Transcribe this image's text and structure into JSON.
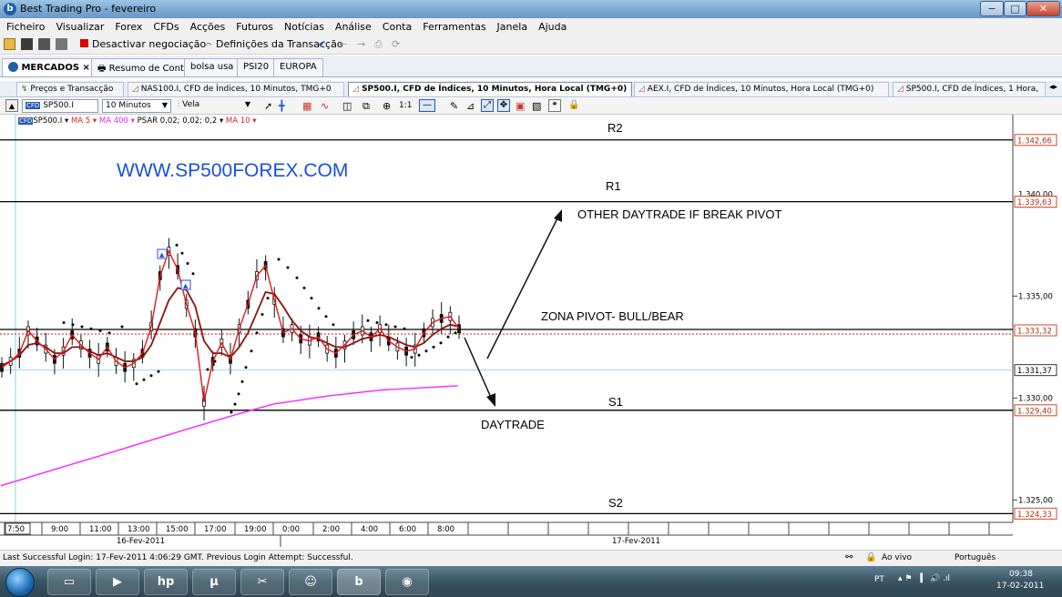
{
  "window": {
    "title": "Best Trading Pro - fevereiro",
    "app_icon": "b",
    "min_label": "−",
    "max_label": "□",
    "close_label": "✕"
  },
  "menu": [
    "Ficheiro",
    "Visualizar",
    "Forex",
    "CFDs",
    "Acções",
    "Futuros",
    "Notícias",
    "Análise",
    "Conta",
    "Ferramentas",
    "Janela",
    "Ajuda"
  ],
  "toolbar": {
    "deactivate_label": "Desactivar negociação",
    "settings_label": "Definições da Transacção"
  },
  "tabs_top": {
    "markets": "MERCADOS",
    "account": "Resumo de Conta",
    "bolsa": "bolsa usa",
    "psi": "PSI20",
    "europa": "EUROPA"
  },
  "tabs_chart": {
    "prices": "Preços e Transacção",
    "nas": "NAS100.I, CFD de Índices, 10 Minutos, TMG+0",
    "sp": "SP500.I, CFD de Índices, 10 Minutos, Hora Local (TMG+0)",
    "aex": "AEX.I, CFD de Índices, 10 Minutos, Hora Local (TMG+0)",
    "sp1h": "SP500.I, CFD de Índices, 1 Hora,"
  },
  "chart_toolbar": {
    "symbol": "SP500.I",
    "interval": "10 Minutos",
    "type": "Vela"
  },
  "indicators": {
    "symbol": "SP500.I",
    "ma5": "MA 5",
    "ma400": "MA 400",
    "psar": "PSAR 0,02; 0,02; 0,2",
    "ma10": "MA 10"
  },
  "annotations": {
    "website": "WWW.SP500FOREX.COM",
    "r2": "R2",
    "r1": "R1",
    "s1": "S1",
    "s2": "S2",
    "pivot": "ZONA PIVOT- BULL/BEAR",
    "other": "OTHER DAYTRADE IF BREAK PIVOT",
    "daytrade": "DAYTRADE"
  },
  "colors": {
    "price_line": "#cc0000",
    "ma400": "#ff22ff",
    "website": "#1a4fd8",
    "level_tag": "#d14a2a"
  },
  "chart_data": {
    "type": "line",
    "symbol": "SP500.I",
    "ylim": [
      1323.9,
      1343.9
    ],
    "y_ticks": [
      1325.0,
      1330.0,
      1335.0
    ],
    "y_tick_labels": [
      "1.325,00",
      "1.330,00",
      "1.335,00"
    ],
    "y_extra_labels": [
      "1.340,00"
    ],
    "levels": [
      {
        "name": "R2",
        "value": 1342.66,
        "label": "1.342,66"
      },
      {
        "name": "R1",
        "value": 1339.63,
        "label": "1.339,63"
      },
      {
        "name": "Pivot",
        "value": 1333.32,
        "label": "1.333,32"
      },
      {
        "name": "S1",
        "value": 1329.4,
        "label": "1.329,40"
      },
      {
        "name": "S2",
        "value": 1324.33,
        "label": "1.324,33"
      }
    ],
    "current_price": {
      "value": 1331.37,
      "label": "1.331,37"
    },
    "x_tick_labels": [
      "7:50",
      "9:00",
      "11:00",
      "13:00",
      "15:00",
      "17:00",
      "19:00",
      "0:00",
      "2:00",
      "4:00",
      "6:00",
      "8:00"
    ],
    "dates": [
      "16-Fev-2011",
      "17-Fev-2011"
    ],
    "price": [
      1331.5,
      1331.8,
      1332.2,
      1333.3,
      1332.8,
      1332.4,
      1331.9,
      1332.3,
      1333.1,
      1332.6,
      1332.2,
      1331.9,
      1332.5,
      1331.8,
      1331.5,
      1331.7,
      1332.2,
      1333.5,
      1336.0,
      1337.2,
      1336.3,
      1334.6,
      1333.2,
      1329.8,
      1331.8,
      1332.7,
      1331.9,
      1333.4,
      1334.6,
      1336.0,
      1336.5,
      1334.8,
      1333.2,
      1333.4,
      1332.9,
      1332.8,
      1333.0,
      1332.4,
      1332.2,
      1332.6,
      1333.1,
      1333.3,
      1333.0,
      1333.4,
      1332.8,
      1332.5,
      1332.3,
      1332.4,
      1333.2,
      1333.7,
      1333.9,
      1334.0,
      1333.4
    ],
    "ma": [
      1331.6,
      1331.8,
      1332.1,
      1332.6,
      1332.7,
      1332.5,
      1332.2,
      1332.2,
      1332.5,
      1332.5,
      1332.3,
      1332.1,
      1332.2,
      1332.0,
      1331.8,
      1331.8,
      1332.0,
      1332.6,
      1333.7,
      1334.8,
      1335.4,
      1335.3,
      1334.5,
      1332.8,
      1332.2,
      1332.2,
      1332.0,
      1332.5,
      1333.2,
      1334.2,
      1335.2,
      1335.1,
      1334.5,
      1333.8,
      1333.3,
      1333.0,
      1332.9,
      1332.7,
      1332.5,
      1332.5,
      1332.7,
      1332.9,
      1333.0,
      1333.1,
      1333.0,
      1332.8,
      1332.6,
      1332.5,
      1332.7,
      1333.1,
      1333.4,
      1333.6,
      1333.5
    ],
    "ma400": [
      [
        1,
        1325.7
      ],
      [
        60,
        1326.5
      ],
      [
        120,
        1327.3
      ],
      [
        200,
        1328.4
      ],
      [
        260,
        1329.2
      ],
      [
        300,
        1329.7
      ],
      [
        360,
        1330.1
      ],
      [
        420,
        1330.4
      ],
      [
        503,
        1330.6
      ]
    ],
    "grid": true
  }
}
